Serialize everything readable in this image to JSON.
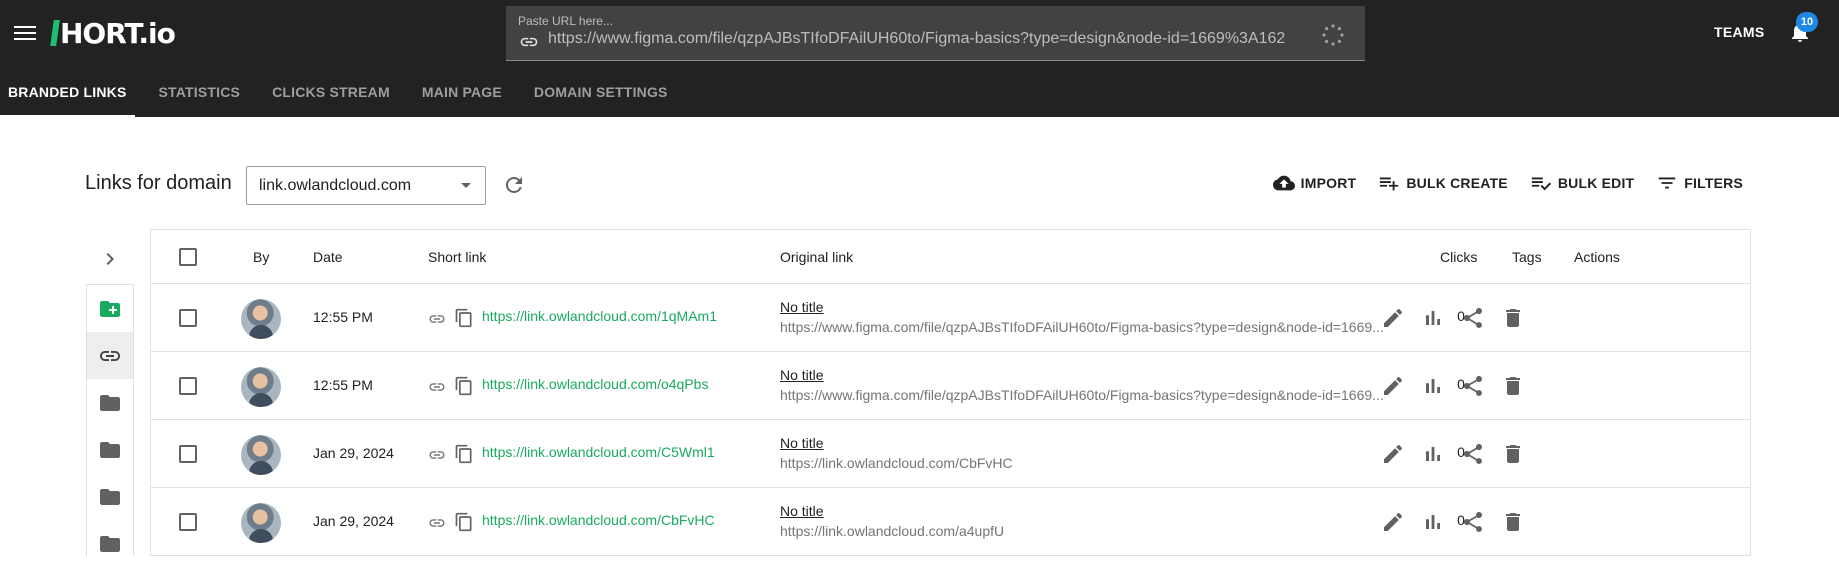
{
  "app": {
    "logo_text": "HORT.io"
  },
  "url_box": {
    "caption": "Paste URL here...",
    "value": "https://www.figma.com/file/qzpAJBsTIfoDFAilUH60to/Figma-basics?type=design&node-id=1669%3A162"
  },
  "header": {
    "teams_label": "TEAMS",
    "notifications_count": "10"
  },
  "tabs": [
    {
      "label": "BRANDED LINKS",
      "active": true
    },
    {
      "label": "STATISTICS"
    },
    {
      "label": "CLICKS STREAM"
    },
    {
      "label": "MAIN PAGE"
    },
    {
      "label": "DOMAIN SETTINGS"
    }
  ],
  "domain": {
    "label": "Links for domain",
    "selected": "link.owlandcloud.com"
  },
  "actions": {
    "import": "IMPORT",
    "bulk_create": "BULK CREATE",
    "bulk_edit": "BULK EDIT",
    "filters": "FILTERS"
  },
  "table": {
    "headers": {
      "by": "By",
      "date": "Date",
      "short_link": "Short link",
      "original_link": "Original link",
      "clicks": "Clicks",
      "tags": "Tags",
      "actions": "Actions"
    },
    "rows": [
      {
        "date": "12:55 PM",
        "short_link": "https://link.owlandcloud.com/1qMAm1",
        "title": "No title",
        "original": "https://www.figma.com/file/qzpAJBsTIfoDFAilUH60to/Figma-basics?type=design&node-id=1669...",
        "clicks": "0"
      },
      {
        "date": "12:55 PM",
        "short_link": "https://link.owlandcloud.com/o4qPbs",
        "title": "No title",
        "original": "https://www.figma.com/file/qzpAJBsTIfoDFAilUH60to/Figma-basics?type=design&node-id=1669...",
        "clicks": "0"
      },
      {
        "date": "Jan 29, 2024",
        "short_link": "https://link.owlandcloud.com/C5Wml1",
        "title": "No title",
        "original": "https://link.owlandcloud.com/CbFvHC",
        "clicks": "0"
      },
      {
        "date": "Jan 29, 2024",
        "short_link": "https://link.owlandcloud.com/CbFvHC",
        "title": "No title",
        "original": "https://link.owlandcloud.com/a4upfU",
        "clicks": "0"
      }
    ]
  },
  "colors": {
    "topbar": "#222222",
    "accent_green": "#1aaa5f",
    "badge_blue": "#1e88e5"
  }
}
